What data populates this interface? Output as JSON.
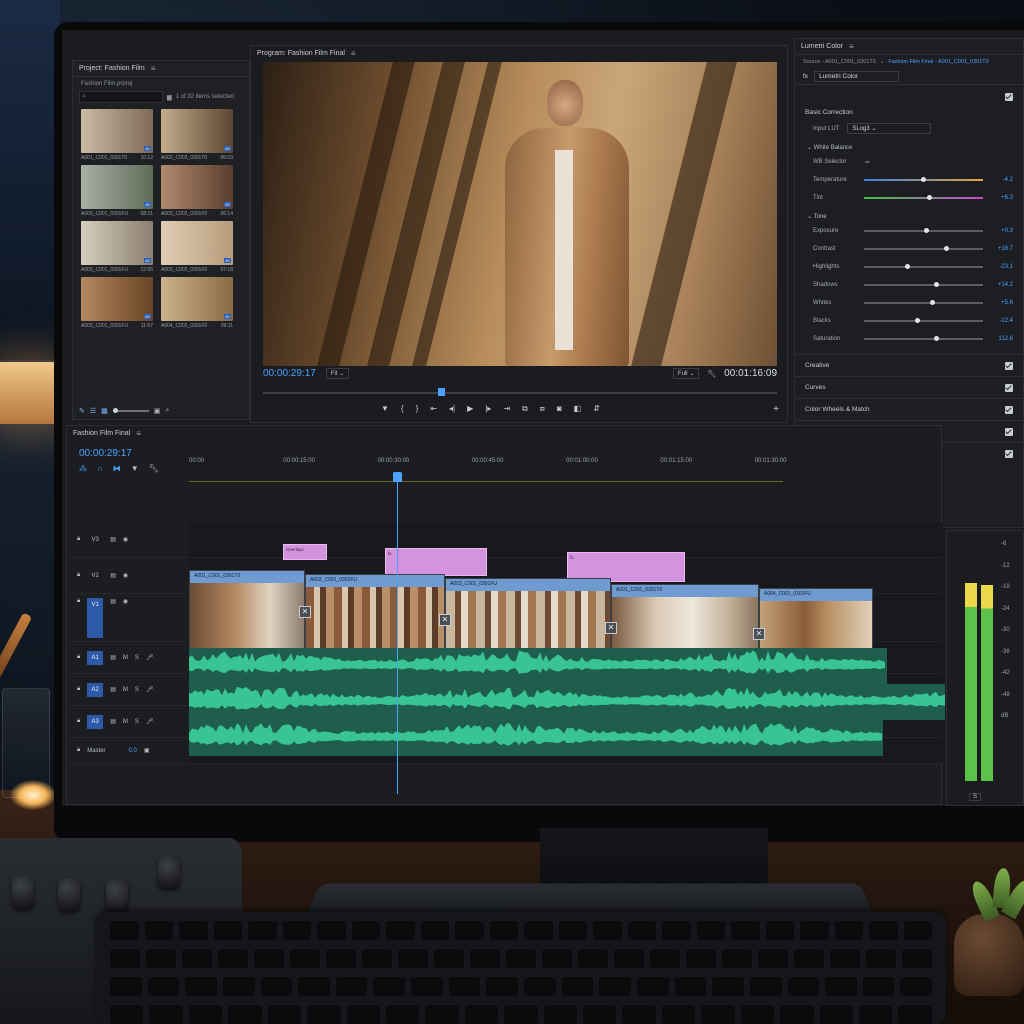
{
  "project": {
    "title": "Project: Fashion Film",
    "file": "Fashion Film.prproj",
    "selection": "1 of 32 items selected",
    "thumbs": [
      {
        "name": "A001_C001_0301T0",
        "duration": "10:12",
        "badge": "4K",
        "colors": [
          "#cbbba4",
          "#7f6a55"
        ]
      },
      {
        "name": "A002_C003_0301T0",
        "duration": "06:03",
        "badge": "4K",
        "colors": [
          "#c3ad8c",
          "#5c4632"
        ]
      },
      {
        "name": "A003_C001_0301FU",
        "duration": "08:21",
        "badge": "4K",
        "colors": [
          "#a9b0a4",
          "#5f6b58"
        ]
      },
      {
        "name": "A003_C002_0301F0",
        "duration": "06:14",
        "badge": "4K",
        "colors": [
          "#b28a6e",
          "#5a3d2e"
        ]
      },
      {
        "name": "A003_C001_0301FU",
        "duration": "12:55",
        "badge": "4K",
        "colors": [
          "#d7cdbd",
          "#8a7f70"
        ]
      },
      {
        "name": "A003_C002_0301F0",
        "duration": "07:18",
        "badge": "4K",
        "colors": [
          "#e0cdb3",
          "#b79c7b"
        ]
      },
      {
        "name": "A003_C001_0301FU",
        "duration": "11:07",
        "badge": "4K",
        "colors": [
          "#b4895f",
          "#6a4427"
        ]
      },
      {
        "name": "A004_C002_0301F0",
        "duration": "09:11",
        "badge": "4K",
        "colors": [
          "#cdb28e",
          "#8a6a45"
        ]
      }
    ]
  },
  "program": {
    "title": "Program: Fashion Film Final",
    "timecode_current": "00:00:29:17",
    "fit": "Fit",
    "quality": "Full",
    "timecode_duration": "00:01:16:09",
    "playhead_fraction": 0.34
  },
  "lumetri": {
    "title": "Lumetri Color",
    "source": "Source - A001_C001_0301T0",
    "link": "Fashion Film Final - A001_C001_0301T0",
    "fx": "fx",
    "fx_name": "Lumetri Color",
    "basic": "Basic Correction",
    "lut_label": "Input LUT",
    "lut_value": "SLog3",
    "wb_head": "White Balance",
    "wb_selector": "WB Selector",
    "tone_head": "Tone",
    "params_wb": [
      {
        "name": "Temperature",
        "value": "-4.2",
        "pos": 0.48
      },
      {
        "name": "Tint",
        "value": "+6.3",
        "pos": 0.53
      }
    ],
    "params_tone": [
      {
        "name": "Exposure",
        "value": "+0.3",
        "pos": 0.5
      },
      {
        "name": "Contrast",
        "value": "+18.7",
        "pos": 0.67
      },
      {
        "name": "Highlights",
        "value": "-23.1",
        "pos": 0.34
      },
      {
        "name": "Shadows",
        "value": "+14.2",
        "pos": 0.59
      },
      {
        "name": "Whites",
        "value": "+5.6",
        "pos": 0.55
      },
      {
        "name": "Blacks",
        "value": "-12.4",
        "pos": 0.43
      },
      {
        "name": "Saturation",
        "value": "112.6",
        "pos": 0.59
      }
    ],
    "folds": [
      "Creative",
      "Curves",
      "Color Wheels & Match",
      "HSL Secondary",
      "Vignette"
    ]
  },
  "timeline": {
    "title": "Fashion Film Final",
    "timecode": "00:00:29:17",
    "ruler": [
      "00:00",
      "00:00:15:00",
      "00:00:30:00",
      "00:00:45:00",
      "00:01:00:00",
      "00:01:15:00",
      "00:01:30:00"
    ],
    "tracks": {
      "v3": "V3",
      "v2": "V2",
      "v1": "V1",
      "a1": "A1",
      "a2": "A2",
      "a3": "A3",
      "master": "Master",
      "master_val": "0.0",
      "m": "M",
      "s": "S"
    },
    "title_clips": [
      {
        "label": "Overlays"
      },
      {
        "label": "fx"
      },
      {
        "label": "fx"
      }
    ],
    "video_clips": [
      {
        "name": "A001_C001_0301T0"
      },
      {
        "name": "A003_C001_0301FU"
      },
      {
        "name": "A003_C001_0301FU"
      },
      {
        "name": "A001_C001_0301T0"
      },
      {
        "name": "A004_C001_0301FU"
      }
    ]
  },
  "meter": {
    "scale": [
      "-6",
      "-12",
      "-18",
      "-24",
      "-30",
      "-36",
      "-42",
      "-48",
      "dB"
    ],
    "s_button": "S",
    "colors": {
      "green": "#5cc24a",
      "yellow": "#e8d84a"
    }
  },
  "colors": {
    "accent": "#4aa3ff",
    "title_clip": "#d493de",
    "video_clip": "#6f9bd1",
    "audio_clip": "#1f5e4d",
    "waveform": "#3ccf9c"
  }
}
